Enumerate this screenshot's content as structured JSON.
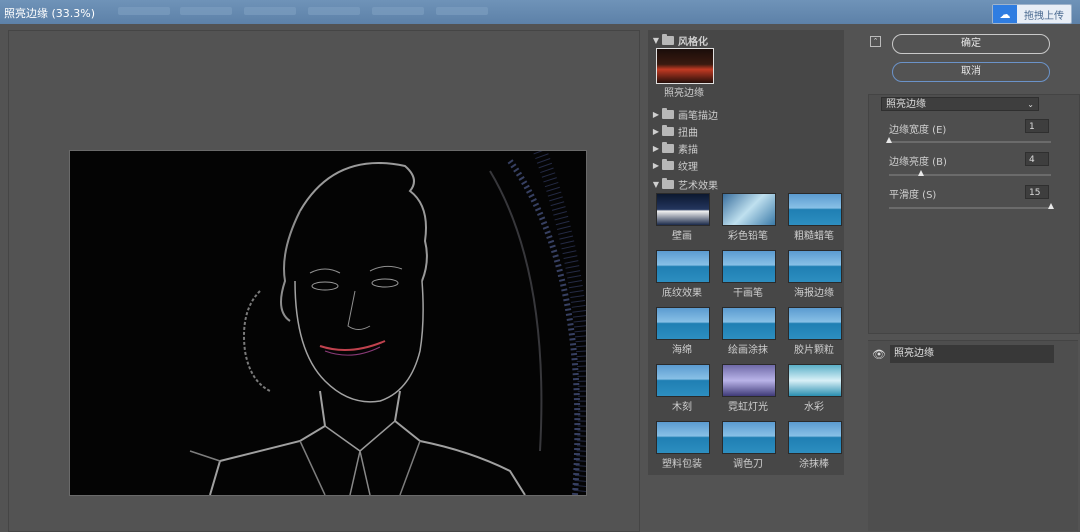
{
  "window": {
    "title": "照亮边缘 (33.3%)"
  },
  "upload": {
    "label": "拖拽上传"
  },
  "gallery": {
    "categories": [
      {
        "label": "风格化",
        "expanded": true
      },
      {
        "label": "画笔描边",
        "expanded": false
      },
      {
        "label": "扭曲",
        "expanded": false
      },
      {
        "label": "素描",
        "expanded": false
      },
      {
        "label": "纹理",
        "expanded": false
      },
      {
        "label": "艺术效果",
        "expanded": true
      }
    ],
    "stylize_filters": [
      "照亮边缘"
    ],
    "artistic_filters": [
      "壁画",
      "彩色铅笔",
      "粗糙蜡笔",
      "底纹效果",
      "干画笔",
      "海报边缘",
      "海绵",
      "绘画涂抹",
      "胶片颗粒",
      "木刻",
      "霓虹灯光",
      "水彩",
      "塑料包装",
      "调色刀",
      "涂抹棒"
    ]
  },
  "actions": {
    "ok": "确定",
    "cancel": "取消"
  },
  "settings": {
    "filter_select": "照亮边缘",
    "params": [
      {
        "label": "边缘宽度 (E)",
        "value": "1",
        "fraction": 0.0
      },
      {
        "label": "边缘亮度 (B)",
        "value": "4",
        "fraction": 0.2
      },
      {
        "label": "平滑度 (S)",
        "value": "15",
        "fraction": 1.0
      }
    ]
  },
  "layers": [
    {
      "name": "照亮边缘"
    }
  ]
}
